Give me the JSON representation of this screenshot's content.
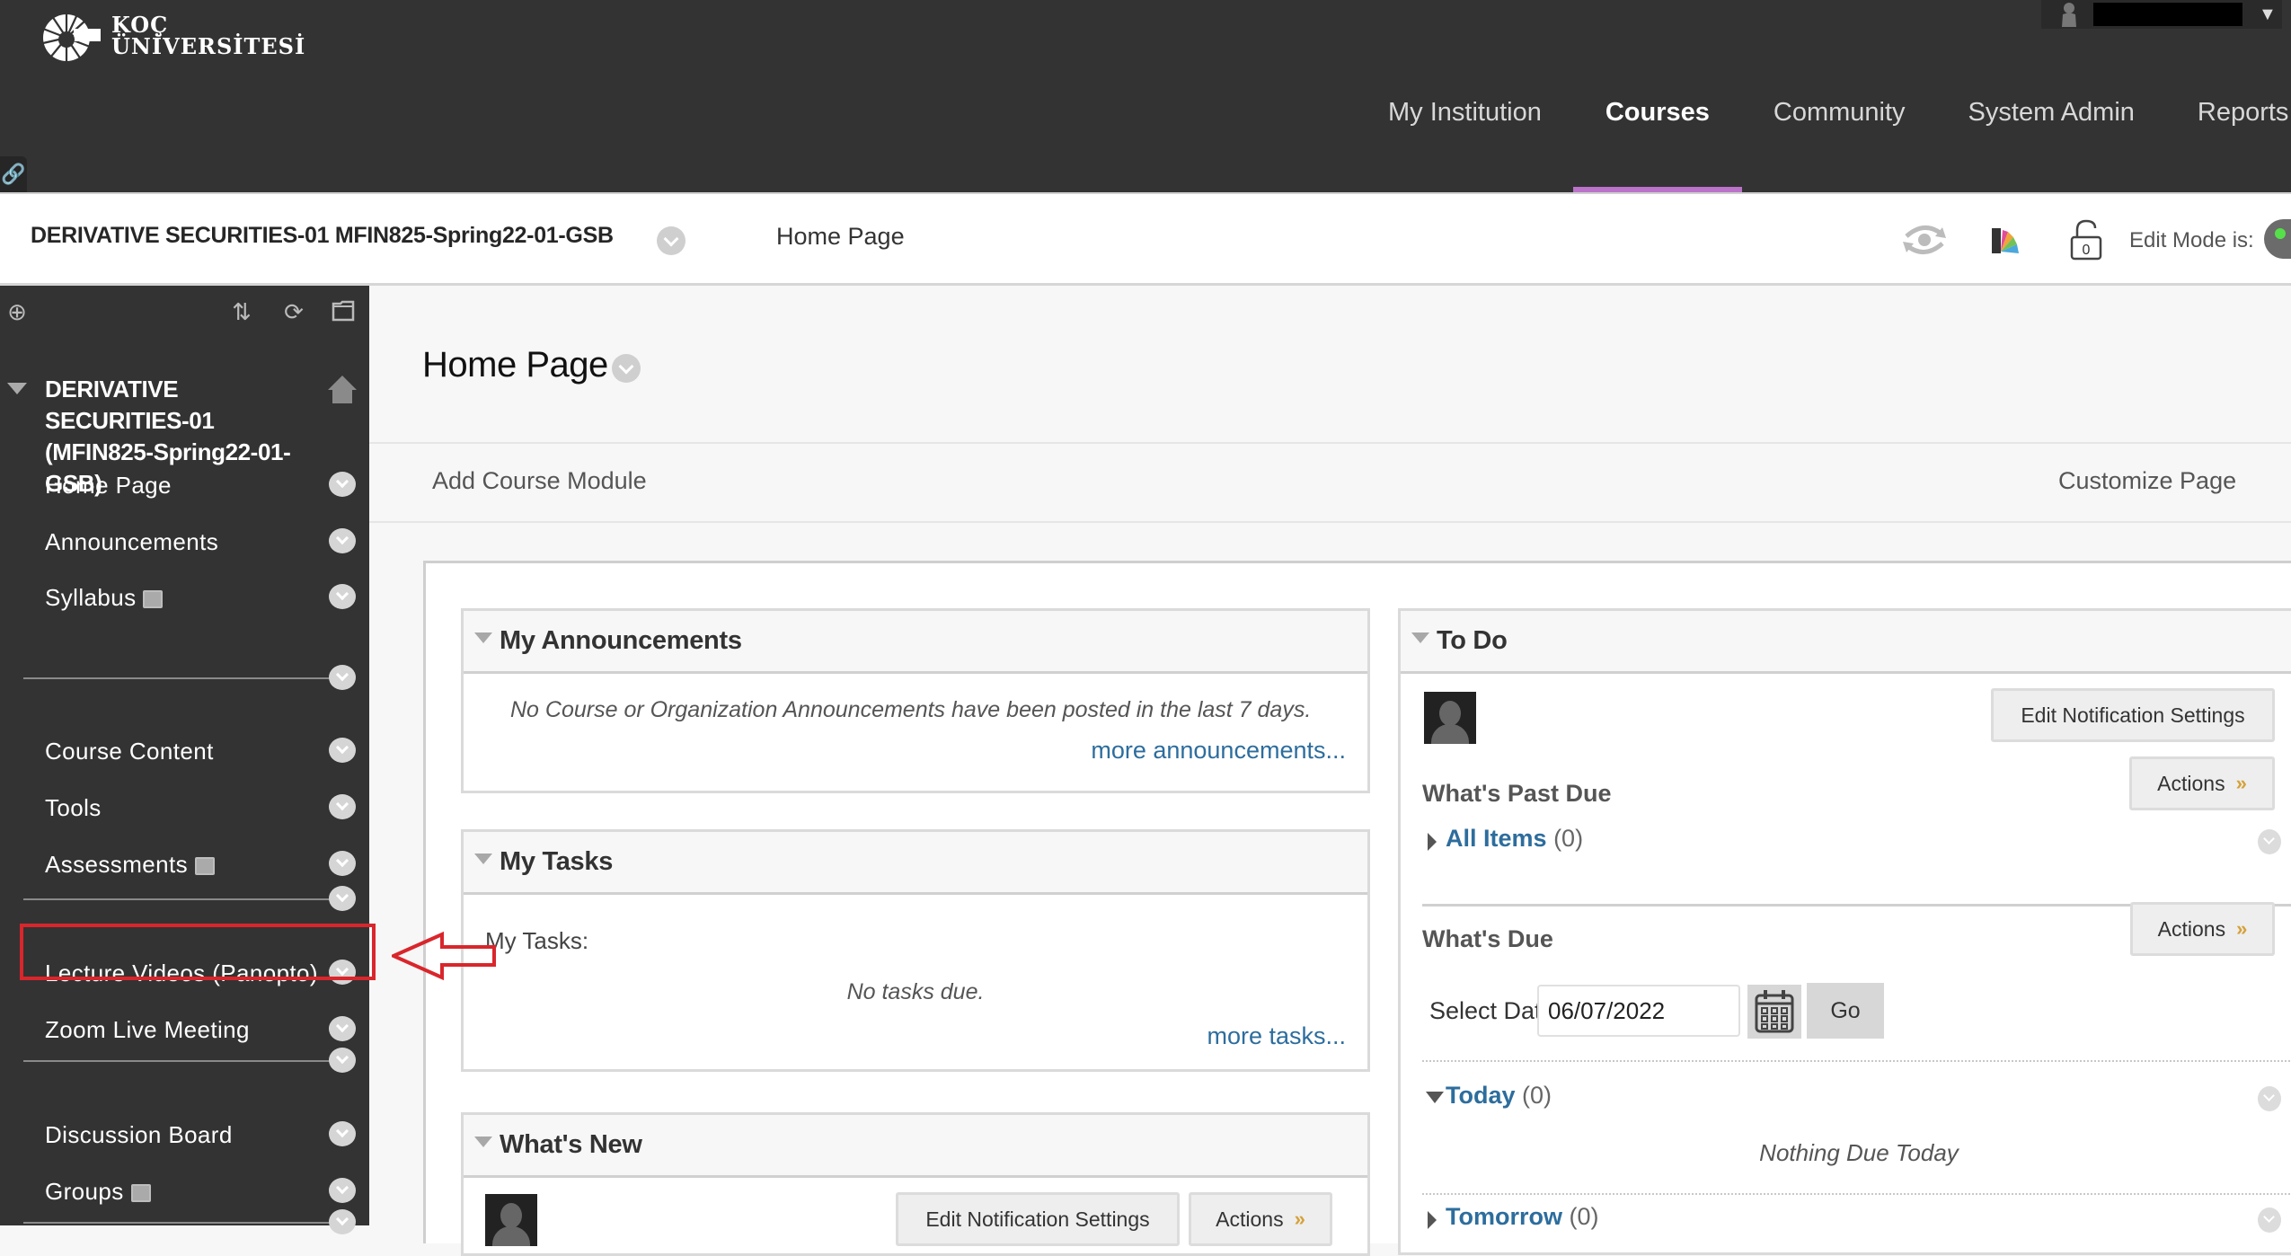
{
  "header": {
    "logo_line1": "KOÇ",
    "logo_line2": "ÜNİVERSİTESİ",
    "nav": [
      {
        "label": "My Institution",
        "active": false
      },
      {
        "label": "Courses",
        "active": true
      },
      {
        "label": "Community",
        "active": false
      },
      {
        "label": "System Admin",
        "active": false
      },
      {
        "label": "Reports",
        "active": false
      }
    ],
    "accent_color": "#bb73c9"
  },
  "course_bar": {
    "course_title": "DERIVATIVE SECURITIES-01 MFIN825-Spring22-01-GSB",
    "breadcrumb": "Home Page",
    "lock_count": "0",
    "edit_mode_label": "Edit Mode is:",
    "edit_mode_on": true
  },
  "sidebar": {
    "course_name": "DERIVATIVE SECURITIES-01 (MFIN825-Spring22-01-GSB)",
    "items": [
      {
        "label": "Home Page",
        "hidden_icon": false
      },
      {
        "label": "Announcements",
        "hidden_icon": false
      },
      {
        "label": "Syllabus",
        "hidden_icon": true
      },
      {
        "label": "Course Content",
        "hidden_icon": false
      },
      {
        "label": "Tools",
        "hidden_icon": false
      },
      {
        "label": "Assessments",
        "hidden_icon": true
      },
      {
        "label": "Lecture Videos (Panopto)",
        "hidden_icon": false,
        "highlighted": true
      },
      {
        "label": "Zoom Live Meeting",
        "hidden_icon": false
      },
      {
        "label": "Discussion Board",
        "hidden_icon": false
      },
      {
        "label": "Groups",
        "hidden_icon": true
      }
    ],
    "highlight_color": "#d9262c"
  },
  "main": {
    "page_title": "Home Page",
    "add_course_module": "Add Course Module",
    "customize_page": "Customize Page",
    "announcements": {
      "title": "My Announcements",
      "message": "No Course or Organization Announcements have been posted in the last 7 days.",
      "more_link": "more announcements..."
    },
    "tasks": {
      "title": "My Tasks",
      "label": "My Tasks:",
      "message": "No tasks due.",
      "more_link": "more tasks..."
    },
    "whats_new": {
      "title": "What's New",
      "edit_notifications": "Edit Notification Settings",
      "actions": "Actions"
    },
    "todo": {
      "title": "To Do",
      "edit_notifications": "Edit Notification Settings",
      "past_due_heading": "What's Past Due",
      "past_due_actions": "Actions",
      "all_items_label": "All Items",
      "all_items_count": "(0)",
      "due_heading": "What's Due",
      "due_actions": "Actions",
      "select_date_label": "Select Date:",
      "select_date_value": "06/07/2022",
      "go_label": "Go",
      "today_label": "Today",
      "today_count": "(0)",
      "nothing_due": "Nothing Due Today",
      "tomorrow_label": "Tomorrow",
      "tomorrow_count": "(0)"
    }
  }
}
